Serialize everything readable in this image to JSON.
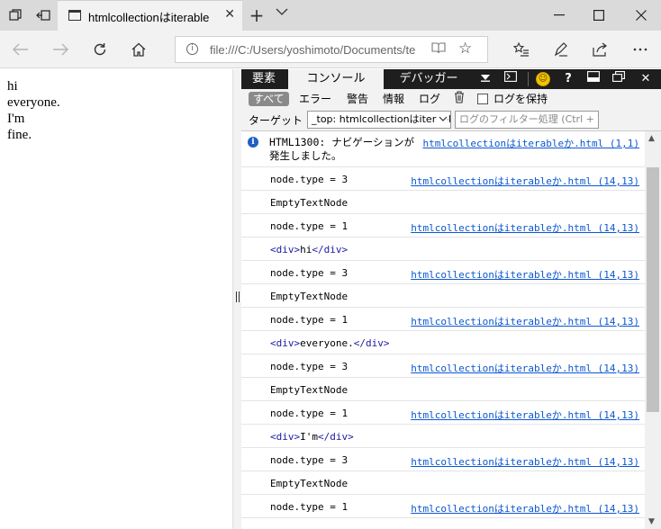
{
  "browser": {
    "tab_title": "htmlcollectionはiterable",
    "address": "file:///C:/Users/yoshimoto/Documents/te"
  },
  "page": {
    "lines": [
      "hi",
      "everyone.",
      "I'm",
      "fine."
    ]
  },
  "devtools": {
    "tabs": {
      "elements": "要素",
      "console": "コンソール",
      "debugger": "デバッガー"
    },
    "filters": {
      "all": "すべて",
      "errors": "エラー",
      "warnings": "警告",
      "info": "情報",
      "log": "ログ",
      "preserve_log": "ログを保持"
    },
    "target": {
      "label": "ターゲット",
      "selected": "_top: htmlcollectionはiterable",
      "filter_placeholder": "ログのフィルター処理 (Ctrl + E)"
    },
    "info_message": {
      "code": "HTML1300:",
      "text_a": "ナビゲーションが",
      "text_b": "発生しました。",
      "source": "htmlcollectionはiterableか.html (1,1)"
    },
    "rows": [
      {
        "text": "node.type = 3",
        "source": "htmlcollectionはiterableか.html (14,13)"
      },
      {
        "text": "EmptyTextNode",
        "source": ""
      },
      {
        "text": "node.type = 1",
        "source": "htmlcollectionはiterableか.html (14,13)"
      },
      {
        "tag_open": "<div>",
        "text": "hi",
        "tag_close": "</div>"
      },
      {
        "text": "node.type = 3",
        "source": "htmlcollectionはiterableか.html (14,13)"
      },
      {
        "text": "EmptyTextNode",
        "source": ""
      },
      {
        "text": "node.type = 1",
        "source": "htmlcollectionはiterableか.html (14,13)"
      },
      {
        "tag_open": "<div>",
        "text": "everyone.",
        "tag_close": "</div>"
      },
      {
        "text": "node.type = 3",
        "source": "htmlcollectionはiterableか.html (14,13)"
      },
      {
        "text": "EmptyTextNode",
        "source": ""
      },
      {
        "text": "node.type = 1",
        "source": "htmlcollectionはiterableか.html (14,13)"
      },
      {
        "tag_open": "<div>",
        "text": "I'm",
        "tag_close": "</div>"
      },
      {
        "text": "node.type = 3",
        "source": "htmlcollectionはiterableか.html (14,13)"
      },
      {
        "text": "EmptyTextNode",
        "source": ""
      },
      {
        "text": "node.type = 1",
        "source": "htmlcollectionはiterableか.html (14,13)"
      }
    ]
  },
  "colors": {
    "link": "#0b57d0",
    "tag": "#1a1aa6",
    "devtools_tab_bar": "#1e1e1e"
  }
}
